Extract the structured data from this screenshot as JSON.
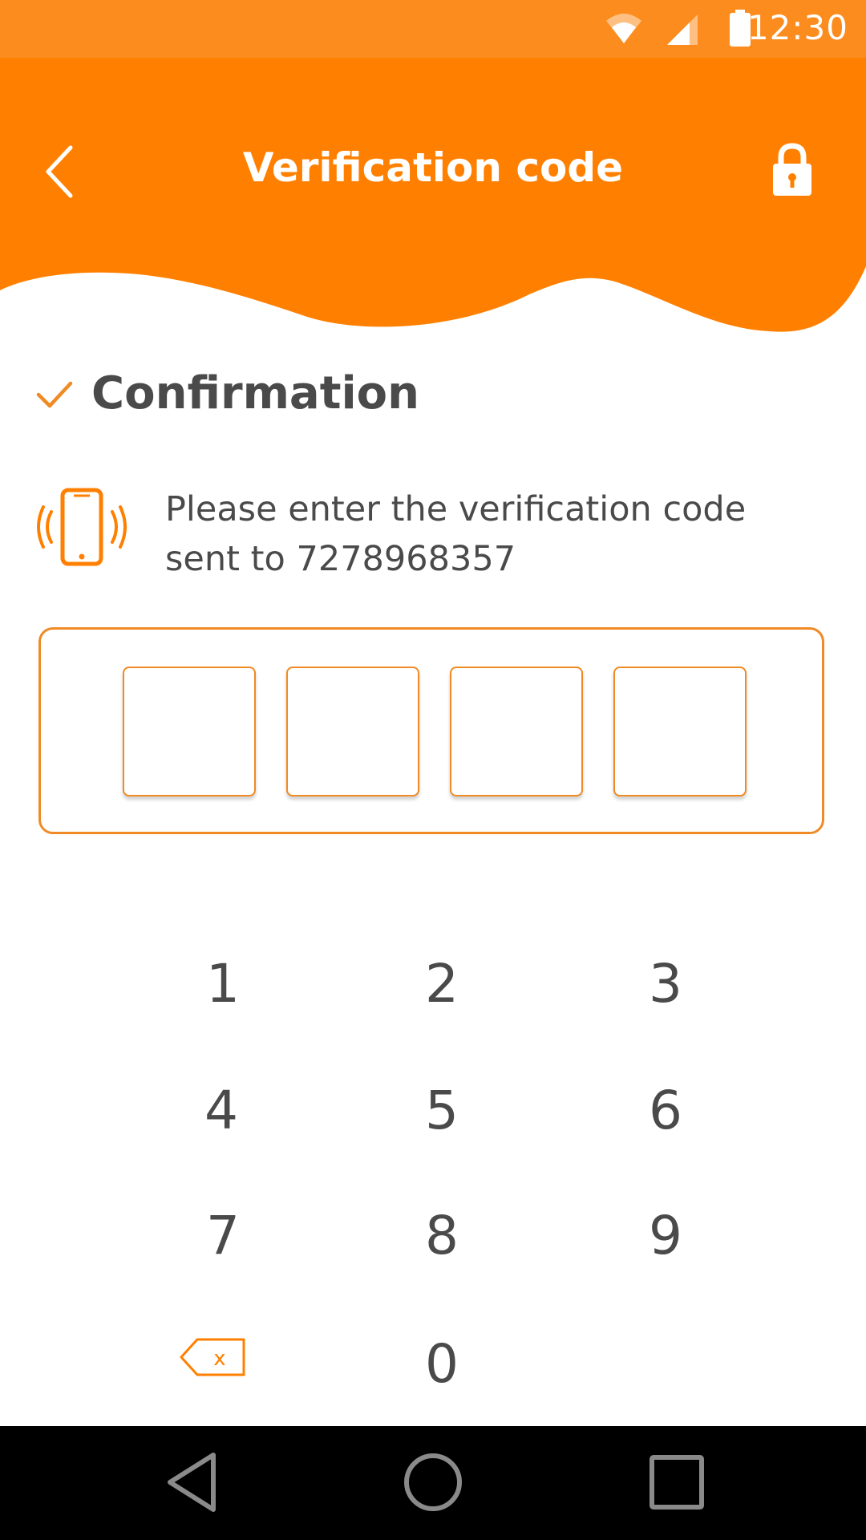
{
  "status_bar": {
    "time": "12:30",
    "icons": [
      "wifi-icon",
      "signal-icon",
      "battery-icon"
    ]
  },
  "header": {
    "title": "Verification code",
    "back_icon": "chevron-left-icon",
    "lock_icon": "lock-icon"
  },
  "confirmation": {
    "title": "Confirmation",
    "icon": "check-icon"
  },
  "instruction": {
    "text": "Please enter the verification code sent to 7278968357",
    "icon": "vibrating-phone-icon"
  },
  "code_inputs": [
    "",
    "",
    "",
    ""
  ],
  "keypad": {
    "keys": [
      "1",
      "2",
      "3",
      "4",
      "5",
      "6",
      "7",
      "8",
      "9",
      "0"
    ],
    "backspace_label": "x"
  },
  "colors": {
    "accent": "#fb8c1d",
    "header": "#ff8000",
    "text": "#4a4a4a",
    "nav_bar": "#000000"
  },
  "nav_bar": {
    "buttons": [
      "back-triangle-icon",
      "home-circle-icon",
      "recents-square-icon"
    ]
  }
}
